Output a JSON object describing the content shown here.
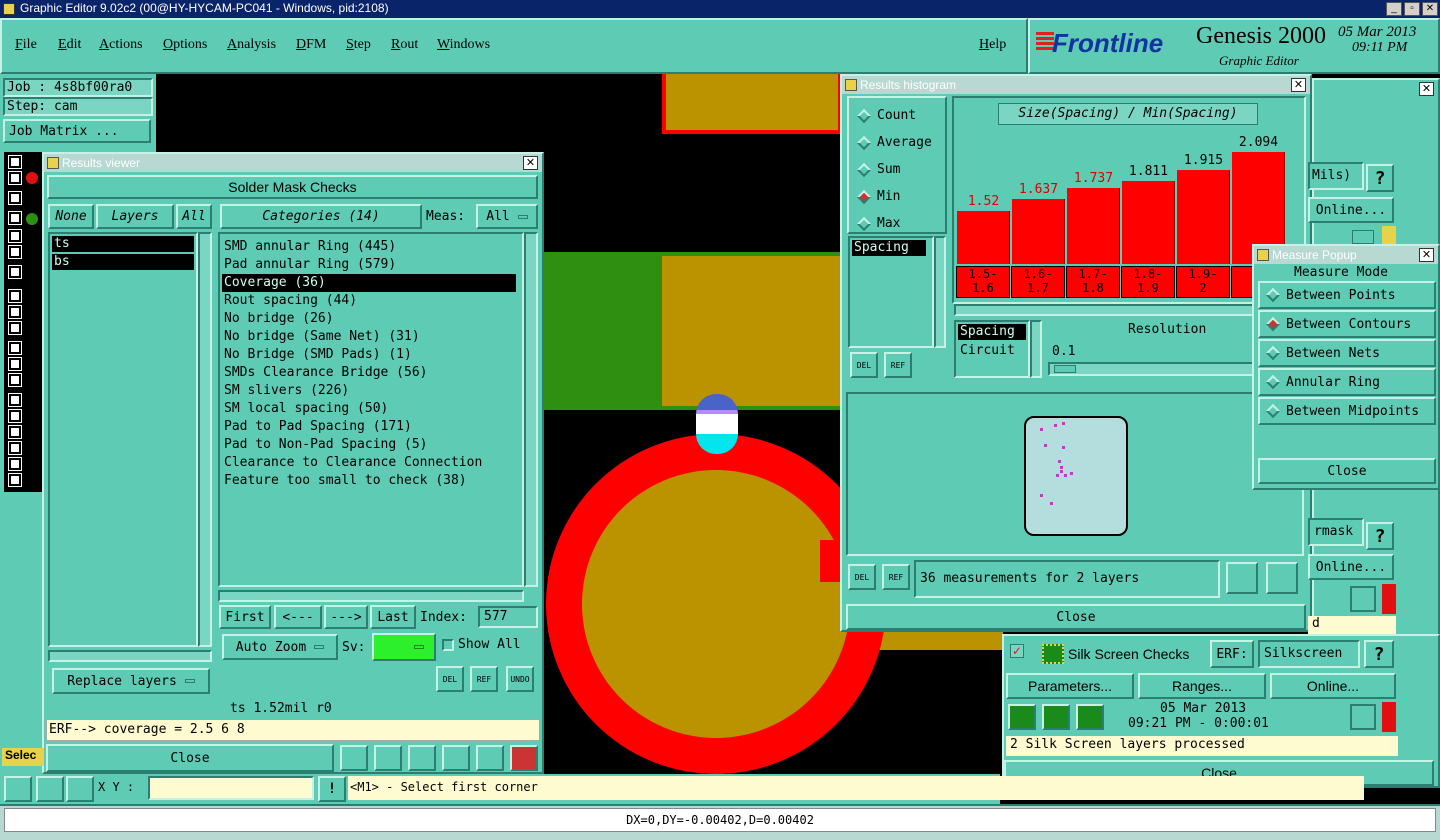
{
  "app": {
    "title": "Graphic Editor 9.02c2 (00@HY-HYCAM-PC041 - Windows, pid:2108)",
    "menu": [
      "File",
      "Edit",
      "Actions",
      "Options",
      "Analysis",
      "DFM",
      "Step",
      "Rout",
      "Windows"
    ],
    "help": "Help",
    "brand": "Frontline",
    "product": "Genesis 2000",
    "subtitle": "Graphic Editor",
    "date": "05 Mar 2013",
    "time": "09:11 PM"
  },
  "job": {
    "job": "Job : 4s8bf00ra0",
    "step": "Step: cam",
    "matrix": "Job Matrix ..."
  },
  "results_viewer": {
    "title": "Results viewer",
    "heading": "Solder Mask Checks",
    "none": "None",
    "layers": "Layers",
    "all": "All",
    "layer_items": [
      "ts",
      "bs"
    ],
    "categories_btn": "Categories (14)",
    "meas_label": "Meas:",
    "meas_value": "All",
    "categories": [
      "SMD annular Ring (445)",
      "Pad annular Ring (579)",
      "Coverage (36)",
      "Rout spacing (44)",
      "No bridge (26)",
      "No bridge (Same Net) (31)",
      "No Bridge (SMD Pads) (1)",
      "SMDs Clearance Bridge (56)",
      "SM slivers (226)",
      "SM local spacing (50)",
      "Pad to Pad Spacing (171)",
      "Pad to Non-Pad Spacing (5)",
      "Clearance to Clearance Connection",
      "Feature too small to check (38)"
    ],
    "first": "First",
    "prev": "<---",
    "next": "--->",
    "last": "Last",
    "index_label": "Index:",
    "index_value": "577",
    "auto_zoom": "Auto Zoom",
    "sv_label": "Sv:",
    "show_all": "Show All",
    "replace_layers": "Replace layers",
    "del": "DEL",
    "ref": "REF",
    "undo": "UNDO",
    "status": "ts 1.52mil  r0",
    "erf": "ERF--> coverage = 2.5 6 8",
    "close": "Close"
  },
  "histogram": {
    "title": "Results histogram",
    "modes": [
      "Count",
      "Average",
      "Sum",
      "Min",
      "Max"
    ],
    "selected_mode": "Min",
    "chart_title": "Size(Spacing) / Min(Spacing)",
    "list_item": "Spacing",
    "values": [
      "1.52",
      "1.637",
      "1.737",
      "1.811",
      "1.915",
      "2.094"
    ],
    "ranges": [
      "1.5-\n1.6",
      "1.6-\n1.7",
      "1.7-\n1.8",
      "1.8-\n1.9",
      "1.9-\n2",
      "2"
    ],
    "lower_list": [
      "Spacing",
      "Circuit"
    ],
    "resolution_label": "Resolution",
    "resolution_value": "0.1",
    "del": "DEL",
    "ref": "REF",
    "measurements": "36 measurements for 2 layers",
    "close": "Close"
  },
  "measure_popup": {
    "title": "Measure Popup",
    "heading": "Measure Mode",
    "options": [
      "Between Points",
      "Between Contours",
      "Between Nets",
      "Annular Ring",
      "Between Midpoints"
    ],
    "selected": "Between Contours",
    "close": "Close"
  },
  "right_panel": {
    "mils": "Mils)",
    "online1": "Online...",
    "rmask": "rmask",
    "online2": "Online...",
    "d": "d",
    "q": "?"
  },
  "silk": {
    "title": "Silk Screen Checks",
    "erf_label": "ERF:",
    "erf_value": "Silkscreen",
    "parameters": "Parameters...",
    "ranges": "Ranges...",
    "online": "Online...",
    "date": "05 Mar 2013",
    "time": "09:21 PM - 0:00:01",
    "status": "2 Silk Screen layers processed",
    "close": "Close"
  },
  "bottom": {
    "xy_label": "X Y :",
    "prompt": "<M1> - Select first corner",
    "selec": "Selec",
    "coords": "DX=0,DY=-0.00402,D=0.00402"
  },
  "colors": {
    "teal": "#5ecbb5",
    "bar": "#f00",
    "pad": "#bb9200",
    "mask": "#2e8f10"
  }
}
